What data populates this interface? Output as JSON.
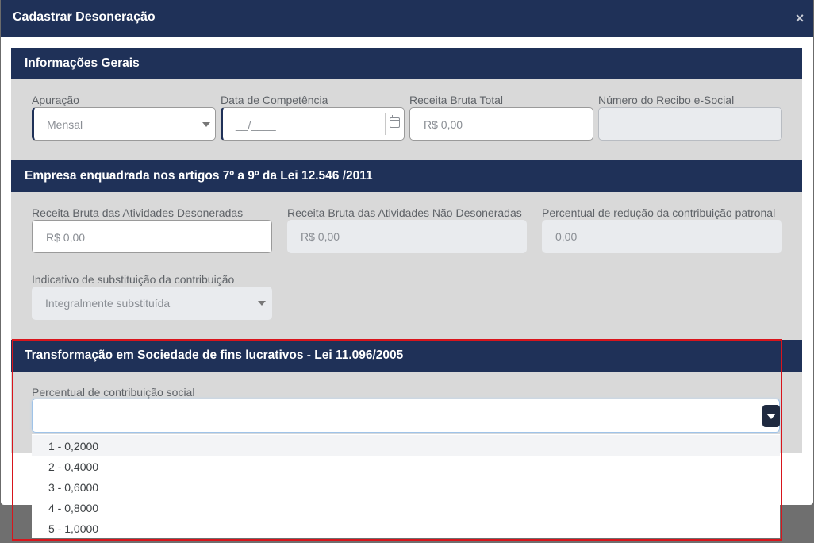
{
  "modal": {
    "title": "Cadastrar Desoneração",
    "close": "×"
  },
  "sections": {
    "general": "Informações Gerais",
    "empresa": "Empresa enquadrada nos artigos 7º a 9º da Lei 12.546 /2011",
    "transform": "Transformação em Sociedade de fins lucrativos - Lei 11.096/2005"
  },
  "general": {
    "apuracao_label": "Apuração",
    "apuracao_value": "Mensal",
    "competencia_label": "Data de Competência",
    "competencia_value": "__/____",
    "receita_total_label": "Receita Bruta Total",
    "receita_total_value": "R$ 0,00",
    "recibo_label": "Número do Recibo e-Social",
    "recibo_value": ""
  },
  "empresa": {
    "desoneradas_label": "Receita Bruta das Atividades Desoneradas",
    "desoneradas_value": "R$ 0,00",
    "nao_desoneradas_label": "Receita Bruta das Atividades Não Desoneradas",
    "nao_desoneradas_value": "R$ 0,00",
    "percentual_label": "Percentual de redução da contribuição patronal",
    "percentual_value": "0,00",
    "indicativo_label": "Indicativo de substituição da contribuição",
    "indicativo_value": "Integralmente substituída"
  },
  "transform": {
    "percentual_label": "Percentual de contribuição social",
    "percentual_value": "",
    "options": [
      "1 - 0,2000",
      "2 - 0,4000",
      "3 - 0,6000",
      "4 - 0,8000",
      "5 - 1,0000"
    ]
  },
  "colors": {
    "navy": "#1f3158",
    "highlight": "#d8151c"
  }
}
